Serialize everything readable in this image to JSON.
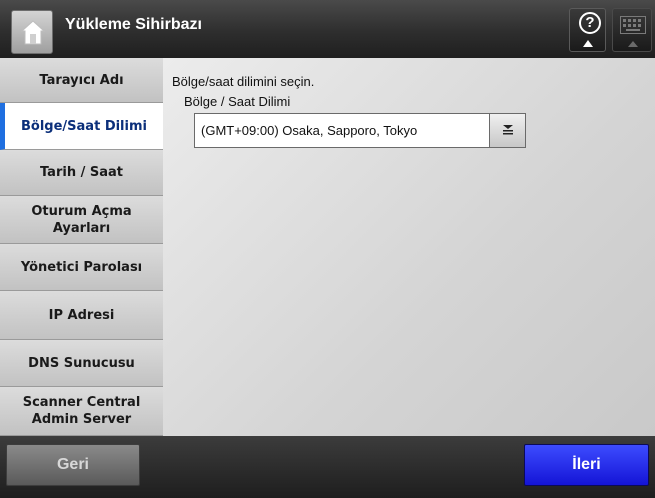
{
  "header": {
    "title": "Yükleme Sihirbazı",
    "home_icon": "home-icon",
    "help_icon": "help-icon",
    "help_glyph": "?",
    "keyboard_icon": "keyboard-icon"
  },
  "sidebar": {
    "items": [
      {
        "label": "Tarayıcı Adı",
        "active": false
      },
      {
        "label": "Bölge/Saat Dilimi",
        "active": true
      },
      {
        "label": "Tarih / Saat",
        "active": false
      },
      {
        "label": "Oturum Açma\nAyarları",
        "active": false
      },
      {
        "label": "Yönetici Parolası",
        "active": false
      },
      {
        "label": "IP Adresi",
        "active": false
      },
      {
        "label": "DNS Sunucusu",
        "active": false
      },
      {
        "label": "Scanner Central\nAdmin Server",
        "active": false
      }
    ]
  },
  "main": {
    "instruction": "Bölge/saat dilimini seçin.",
    "timezone_label": "Bölge / Saat Dilimi",
    "timezone_value": "(GMT+09:00) Osaka, Sapporo, Tokyo"
  },
  "footer": {
    "back_label": "Geri",
    "next_label": "İleri"
  },
  "colors": {
    "active_accent": "#1f6fe0",
    "next_button": "#2222e0"
  }
}
